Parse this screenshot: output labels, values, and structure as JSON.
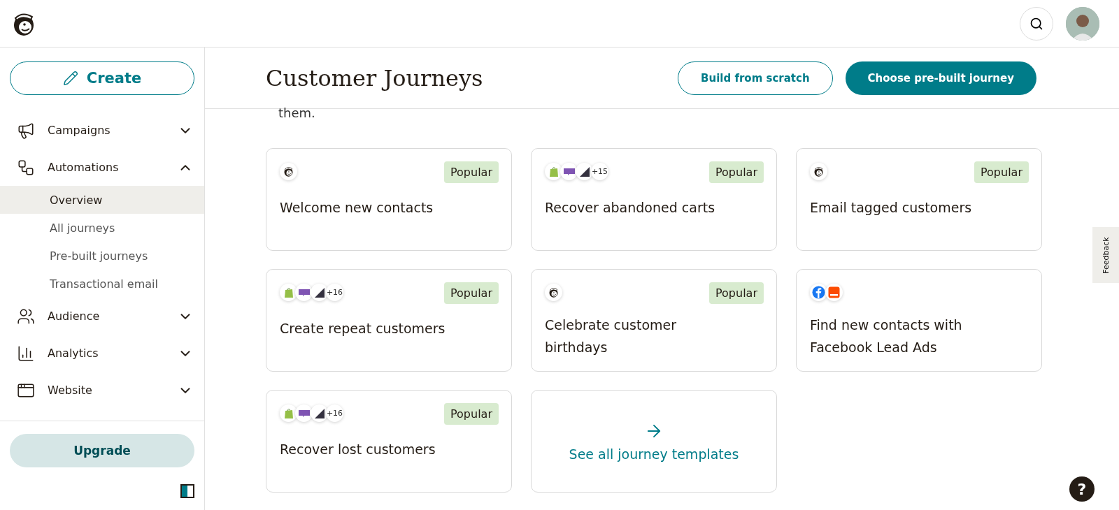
{
  "sidebar": {
    "create_button": "Create",
    "items": [
      {
        "label": "Campaigns",
        "kind": "campaigns",
        "expanded": false
      },
      {
        "label": "Automations",
        "kind": "automations",
        "expanded": true,
        "children": [
          {
            "label": "Overview",
            "selected": true
          },
          {
            "label": "All journeys",
            "selected": false
          },
          {
            "label": "Pre-built journeys",
            "selected": false
          },
          {
            "label": "Transactional email",
            "selected": false
          }
        ]
      },
      {
        "label": "Audience",
        "kind": "audience",
        "expanded": false
      },
      {
        "label": "Analytics",
        "kind": "analytics",
        "expanded": false
      },
      {
        "label": "Website",
        "kind": "website",
        "expanded": false
      }
    ],
    "upgrade_button": "Upgrade"
  },
  "page": {
    "title": "Customer Journeys",
    "secondary_button": "Build from scratch",
    "primary_button": "Choose pre-built journey",
    "intro_fragment": "them."
  },
  "cards": [
    {
      "title": "Welcome new contacts",
      "badge": "Popular",
      "integrations": [
        {
          "kind": "mailchimp"
        }
      ]
    },
    {
      "title": "Recover abandoned carts",
      "badge": "Popular",
      "integrations": [
        {
          "kind": "shopify"
        },
        {
          "kind": "woo"
        },
        {
          "kind": "bigcommerce"
        },
        {
          "kind": "more",
          "label": "+15"
        }
      ]
    },
    {
      "title": "Email tagged customers",
      "badge": "Popular",
      "integrations": [
        {
          "kind": "mailchimp"
        }
      ]
    },
    {
      "title": "Create repeat customers",
      "badge": "Popular",
      "integrations": [
        {
          "kind": "shopify"
        },
        {
          "kind": "woo"
        },
        {
          "kind": "bigcommerce"
        },
        {
          "kind": "more",
          "label": "+16"
        }
      ]
    },
    {
      "title": "Celebrate customer birthdays",
      "badge": "Popular",
      "integrations": [
        {
          "kind": "mailchimp"
        }
      ]
    },
    {
      "title": "Find new contacts with Facebook Lead Ads",
      "integrations": [
        {
          "kind": "facebook"
        },
        {
          "kind": "leadform"
        }
      ]
    },
    {
      "title": "Recover lost customers",
      "badge": "Popular",
      "integrations": [
        {
          "kind": "shopify"
        },
        {
          "kind": "woo"
        },
        {
          "kind": "bigcommerce"
        },
        {
          "kind": "more",
          "label": "+16"
        }
      ]
    }
  ],
  "see_all_link": "See all journey templates",
  "feedback_tab": "Feedback",
  "help_button": "?"
}
